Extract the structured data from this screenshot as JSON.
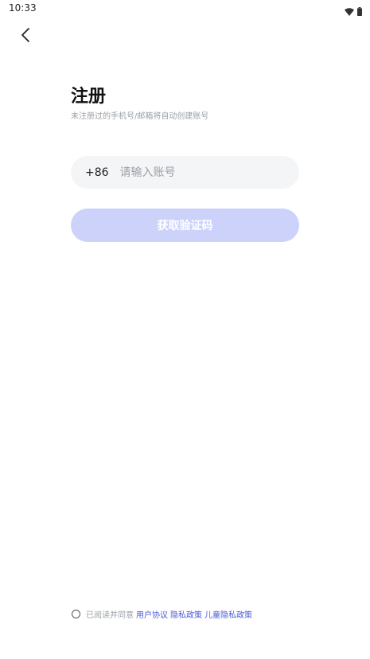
{
  "status_bar": {
    "time": "10:33",
    "icons": [
      "wifi-icon",
      "battery-icon"
    ]
  },
  "header": {
    "back_icon": "chevron-left-icon"
  },
  "page": {
    "title": "注册",
    "subtitle": "未注册过的手机号/邮箱将自动创建账号"
  },
  "account_field": {
    "country_code": "+86",
    "placeholder": "请输入账号",
    "value": ""
  },
  "code_button": {
    "label": "获取验证码"
  },
  "agreement": {
    "prefix": "已阅读并同意",
    "links": [
      "用户协议",
      "隐私政策",
      "儿童隐私政策"
    ],
    "checked": false
  },
  "colors": {
    "button_disabled": "#cdd2fb",
    "link": "#4a5bd4",
    "field_bg": "#f4f5f7",
    "muted_text": "#9aa0a6"
  }
}
